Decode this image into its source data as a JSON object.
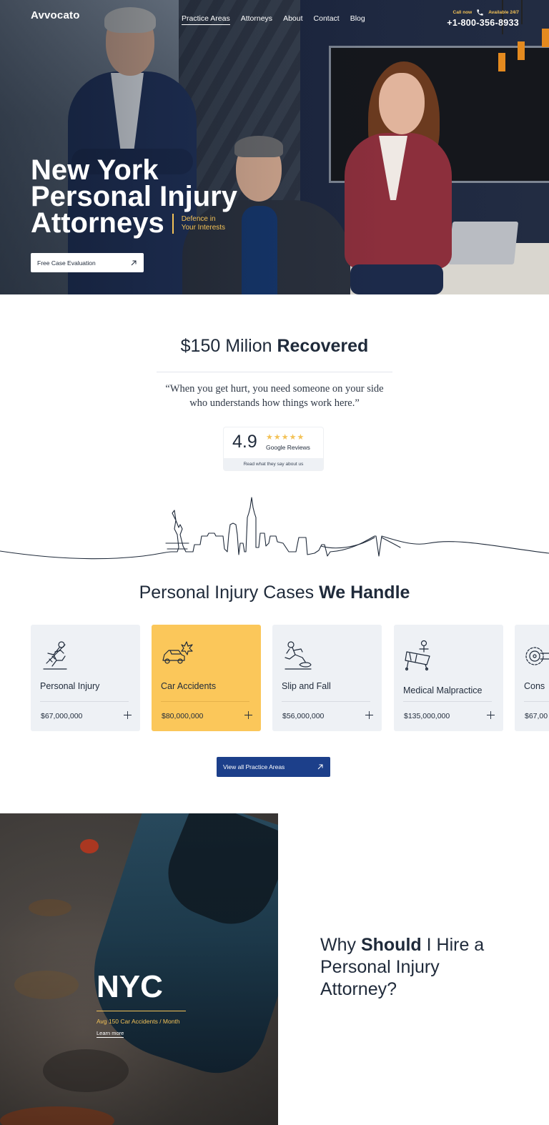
{
  "nav": {
    "logo": "Avvocato",
    "items": [
      {
        "label": "Practice Areas",
        "active": true
      },
      {
        "label": "Attorneys"
      },
      {
        "label": "About"
      },
      {
        "label": "Contact"
      },
      {
        "label": "Blog"
      }
    ],
    "call_now": "Call now",
    "available": "Available 24/7",
    "phone": "+1-800-356-8933"
  },
  "hero": {
    "title_lines": [
      "New York",
      "Personal Injury",
      "Attorneys"
    ],
    "tagline_lines": [
      "Defence in",
      "Your Interests"
    ],
    "cta": "Free Case Evaluation"
  },
  "recovered": {
    "amount": "$150 Milion",
    "word": "Recovered",
    "quote_lines": [
      "“When you get hurt, you need someone on your side",
      "who understands how things work here.”"
    ]
  },
  "reviews": {
    "rating": "4.9",
    "stars": "★★★★★",
    "source": "Google Reviews",
    "footer": "Read what they say about us"
  },
  "cases": {
    "title_normal": "Personal Injury Cases",
    "title_bold": "We Handle",
    "items": [
      {
        "name": "Personal Injury",
        "amount": "$67,000,000",
        "icon": "falling-person-icon"
      },
      {
        "name": "Car Accidents",
        "amount": "$80,000,000",
        "icon": "car-crash-icon",
        "highlighted": true
      },
      {
        "name": "Slip and Fall",
        "amount": "$56,000,000",
        "icon": "slipping-person-icon"
      },
      {
        "name": "Medical Malpractice",
        "amount": "$135,000,000",
        "icon": "medical-bed-icon"
      },
      {
        "name": "Cons",
        "amount": "$67,00",
        "icon": "saw-blade-icon"
      }
    ],
    "view_all": "View all Practice Areas"
  },
  "nyc": {
    "title": "NYC",
    "subtitle": "Avg 150 Car Accidents / Month",
    "link": "Learn more"
  },
  "why": {
    "pre": "Why",
    "bold": "Should",
    "post": "I Hire a",
    "line2": "Personal Injury",
    "line3": "Attorney?"
  },
  "colors": {
    "accent_yellow": "#fbc75a",
    "navy_button": "#1c3f8a",
    "text_dark": "#1f2a3a",
    "card_bg": "#eef1f5"
  }
}
